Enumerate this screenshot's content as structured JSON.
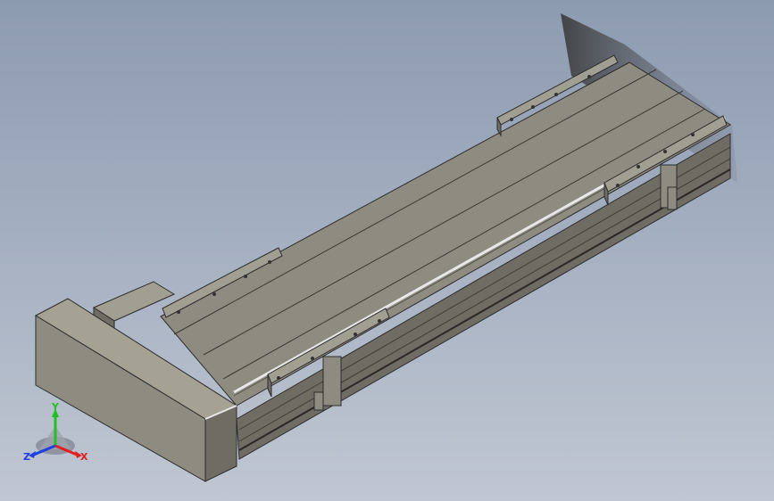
{
  "viewport": {
    "background_top": "#8d9bb0",
    "background_bottom": "#c0c7d2",
    "model_color": "#8e8b80"
  },
  "triad": {
    "x_label": "X",
    "y_label": "Y",
    "z_label": "Z",
    "x_color": "#e02020",
    "y_color": "#20c020",
    "z_color": "#2040e0"
  }
}
